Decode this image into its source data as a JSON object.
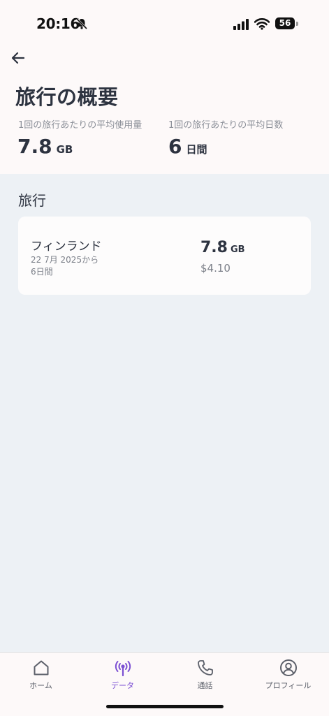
{
  "status_bar": {
    "time": "20:16",
    "battery": "56"
  },
  "header": {
    "title": "旅行の概要"
  },
  "stats": {
    "avg_usage_label": "1回の旅行あたりの平均使用量",
    "avg_usage_value": "7.8",
    "avg_usage_unit": "GB",
    "avg_days_label": "1回の旅行あたりの平均日数",
    "avg_days_value": "6",
    "avg_days_unit": "日間"
  },
  "trips": {
    "section_title": "旅行",
    "items": [
      {
        "country": "フィンランド",
        "date": "22 7月 2025から",
        "duration": "6日間",
        "usage_value": "7.8",
        "usage_unit": "GB",
        "price": "$4.10"
      }
    ]
  },
  "tabs": [
    {
      "label": "ホーム",
      "icon": "home-icon",
      "active": false
    },
    {
      "label": "データ",
      "icon": "antenna-icon",
      "active": true
    },
    {
      "label": "通話",
      "icon": "phone-icon",
      "active": false
    },
    {
      "label": "プロフィール",
      "icon": "user-icon",
      "active": false
    }
  ],
  "colors": {
    "accent": "#7b4fd3",
    "header_bg": "#fdf9f9",
    "body_bg": "#edf1f5"
  }
}
